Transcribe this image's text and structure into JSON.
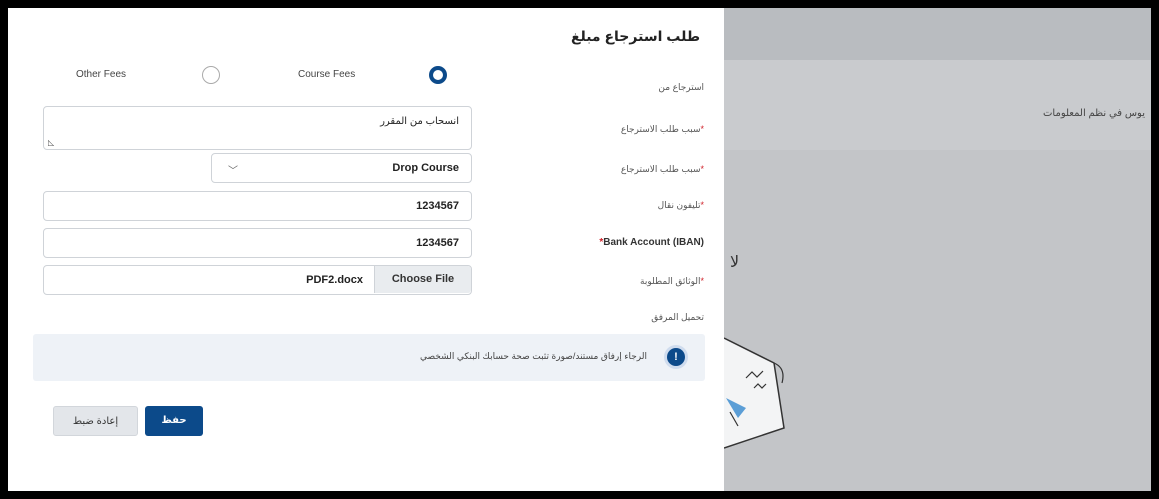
{
  "background": {
    "band_text": "يوس في نظم المعلومات",
    "side_char": "لا"
  },
  "drawer": {
    "title": "طلب استرجاع مبلغ",
    "refund_from": {
      "label": "استرجاع من",
      "options": [
        {
          "label": "Course Fees",
          "selected": true
        },
        {
          "label": "Other Fees",
          "selected": false
        }
      ]
    },
    "reason_text": {
      "label": "سبب طلب الاسترجاع",
      "required_mark": "*",
      "value": "انسحاب من المقرر"
    },
    "reason_select": {
      "label": "سبب طلب الاسترجاع",
      "required_mark": "*",
      "value": "Drop Course"
    },
    "mobile": {
      "label": "تليفون نقال",
      "required_mark": "*",
      "value": "1234567"
    },
    "iban": {
      "label": "Bank Account (IBAN)",
      "required_mark": "*",
      "value": "1234567"
    },
    "documents": {
      "label": "الوثائق المطلوبة",
      "required_mark": "*",
      "button_label": "Choose File",
      "file_name": "PDF2.docx"
    },
    "download_label": "تحميل المرفق",
    "note": "الرجاء إرفاق مستند/صورة تثبت صحة حسابك البنكي الشخصي",
    "info_icon": "!",
    "save_label": "حفظ",
    "reset_label": "إعادة ضبط"
  },
  "colors": {
    "primary": "#0c4a8a",
    "required": "#d0222a",
    "note_bg": "#eef2f7",
    "overlay": "#bcbfc4"
  }
}
